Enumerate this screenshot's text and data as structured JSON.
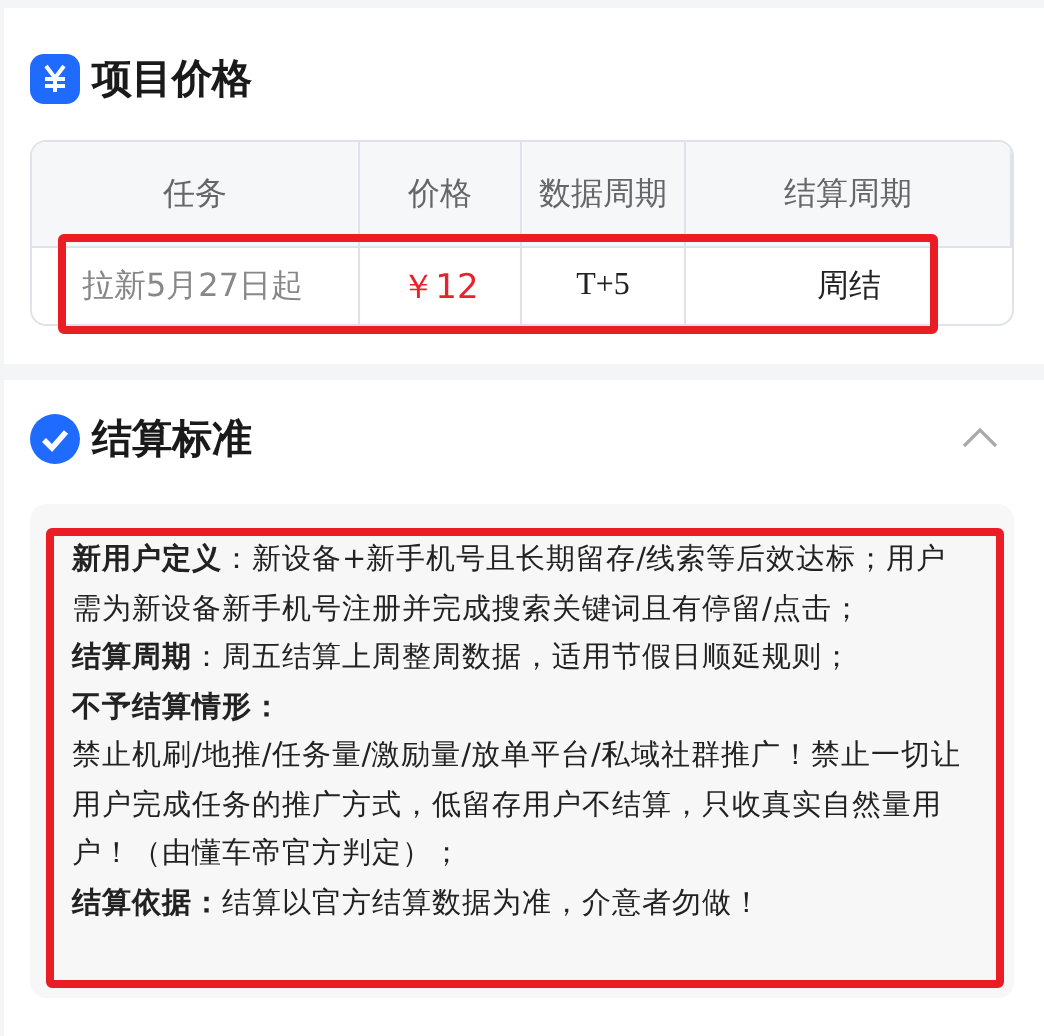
{
  "price_section": {
    "title": "项目价格",
    "table": {
      "columns": [
        "任务",
        "价格",
        "数据周期",
        "结算周期"
      ],
      "rows": [
        {
          "task": "拉新5月27日起",
          "price": "￥12",
          "data_cycle": "T+5",
          "settle_cycle": "周结"
        }
      ]
    }
  },
  "settlement_section": {
    "title": "结算标准",
    "expanded": true,
    "paragraphs": [
      {
        "kind": "text",
        "text": "**新用户定义**：新设备+新手机号且长期留存/线索等后效达标；用户需为新设备新手机号注册并完成搜索关键词且有停留/点击；"
      },
      {
        "kind": "text",
        "text": "**结算周期**：周五结算上周整周数据，适用节假日顺延规则；"
      },
      {
        "kind": "heading",
        "text": "不予结算情形："
      },
      {
        "kind": "text",
        "text": "禁止机刷/地推/任务量/激励量/放单平台/私域社群推广！禁止一切让用户完成任务的推广方式，低留存用户不结算，只收真实自然量用户！（由懂车帝官方判定）；"
      },
      {
        "kind": "text",
        "text": "**结算依据：**结算以官方结算数据为准，介意者勿做！"
      }
    ]
  }
}
